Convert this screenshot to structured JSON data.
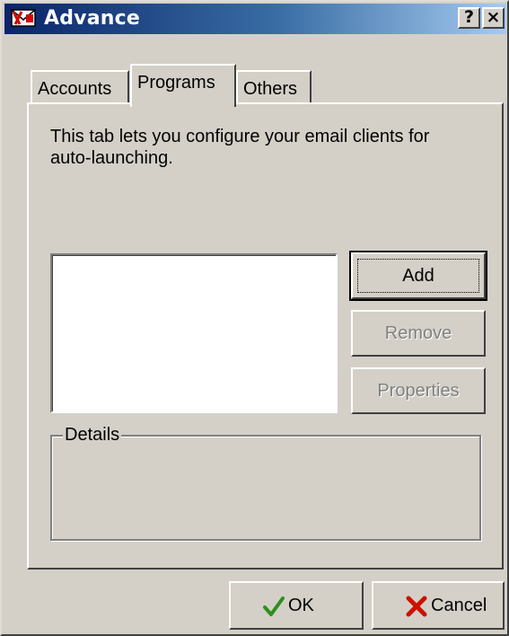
{
  "window": {
    "title": "Advance",
    "help_glyph": "?",
    "close_glyph": "×"
  },
  "tabs": [
    {
      "label": "Accounts",
      "selected": false
    },
    {
      "label": "Programs",
      "selected": true
    },
    {
      "label": "Others",
      "selected": false
    }
  ],
  "programs": {
    "description": "This tab lets you configure your email clients for auto-launching.",
    "clients": [],
    "buttons": {
      "add": "Add",
      "remove": "Remove",
      "properties": "Properties"
    },
    "details_label": "Details"
  },
  "footer": {
    "ok": "OK",
    "cancel": "Cancel"
  },
  "colors": {
    "face": "#d4d0c8",
    "title_start": "#0a246a",
    "title_end": "#a6caf0",
    "ok_icon": "#2f8f1f",
    "cancel_icon": "#cc1100"
  },
  "icons": {
    "app": "mail-launcher-icon",
    "ok": "checkmark-icon",
    "cancel": "red-x-icon"
  }
}
